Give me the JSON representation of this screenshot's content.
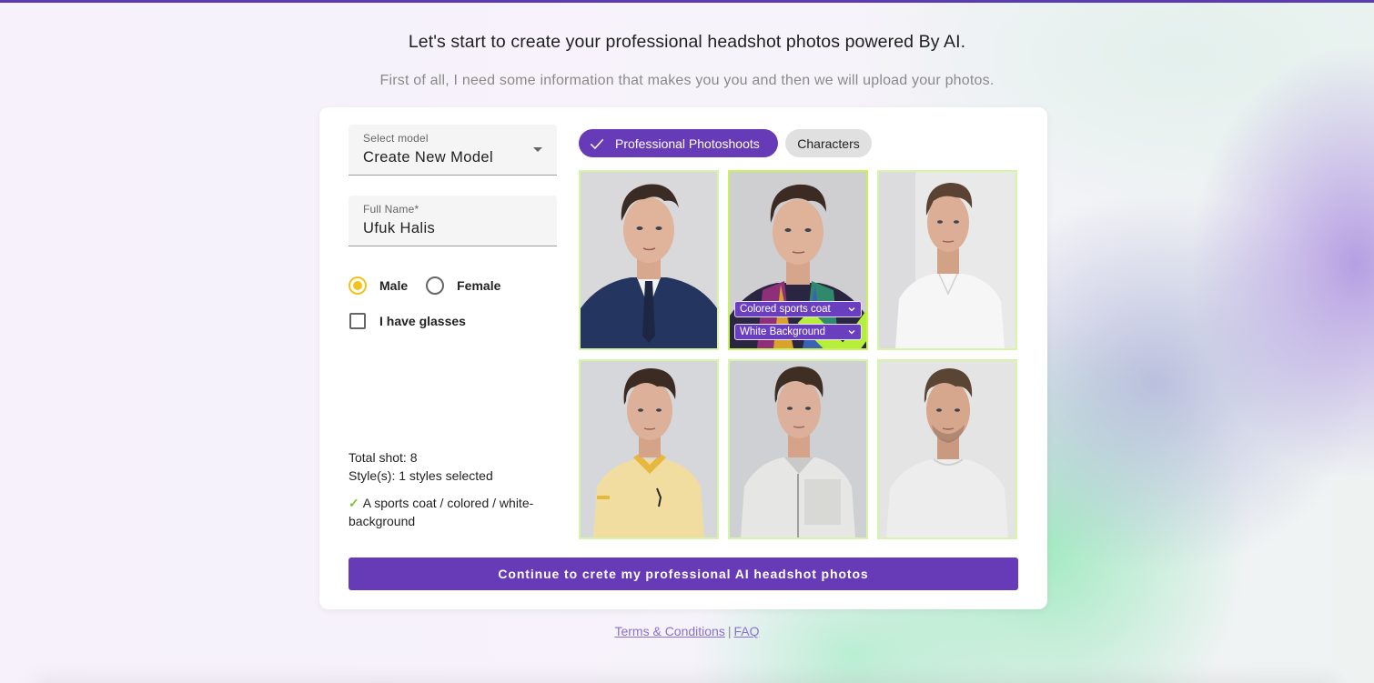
{
  "header": {
    "headline": "Let's start to create your professional headshot photos powered By AI.",
    "subline": "First of all, I need some information that makes you you and then we will upload your photos."
  },
  "form": {
    "model": {
      "label": "Select model",
      "value": "Create New Model"
    },
    "full_name": {
      "label": "Full Name*",
      "value": "Ufuk Halis"
    },
    "gender": {
      "options": [
        {
          "label": "Male",
          "selected": true
        },
        {
          "label": "Female",
          "selected": false
        }
      ]
    },
    "glasses": {
      "label": "I have glasses",
      "checked": false
    }
  },
  "summary": {
    "total": "Total shot: 8",
    "styles": "Style(s): 1 styles selected",
    "check_mark": "✓",
    "selected_item": "A sports coat / colored / white-background"
  },
  "tabs": [
    {
      "label": "Professional Photoshoots",
      "active": true
    },
    {
      "label": "Characters",
      "active": false
    }
  ],
  "styles": [
    {
      "name": "navy-suit",
      "selected": false
    },
    {
      "name": "colored-sports-coat",
      "selected": true,
      "dropdowns": [
        "Colored sports coat",
        "White Background"
      ]
    },
    {
      "name": "white-shirt",
      "selected": false
    },
    {
      "name": "yellow-polo",
      "selected": false
    },
    {
      "name": "knit-cardigan",
      "selected": false
    },
    {
      "name": "white-tshirt",
      "selected": false
    }
  ],
  "continue_label": "Continue to crete my professional AI headshot photos",
  "footer": {
    "terms": "Terms & Conditions",
    "separator": "|",
    "faq": "FAQ"
  },
  "colors": {
    "primary": "#673ab7",
    "accent_yellow": "#f3c21c",
    "selected_border": "#c7f25a",
    "check_green": "#7cc23c"
  },
  "icons": [
    "check-icon",
    "dropdown-caret-icon",
    "chevron-down-icon",
    "selected-check-icon"
  ]
}
